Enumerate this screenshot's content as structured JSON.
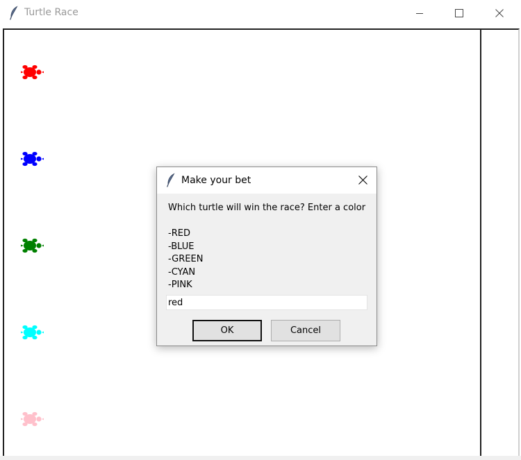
{
  "window": {
    "title": "Turtle Race",
    "icon": "feather-icon",
    "controls": [
      "minimize-icon",
      "maximize-icon",
      "close-icon"
    ]
  },
  "turtles": [
    {
      "color": "#ff0000"
    },
    {
      "color": "#0000ff"
    },
    {
      "color": "#008000"
    },
    {
      "color": "#00ffff"
    },
    {
      "color": "#ffc0cb"
    }
  ],
  "dialog": {
    "title": "Make your bet",
    "prompt": "Which turtle will win the race? Enter a color",
    "options": [
      "-RED",
      "-BLUE",
      "-GREEN",
      "-CYAN",
      "-PINK"
    ],
    "input_value": "red",
    "ok_label": "OK",
    "cancel_label": "Cancel"
  }
}
